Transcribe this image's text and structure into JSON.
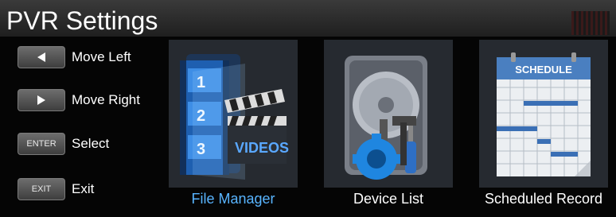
{
  "header": {
    "title": "PVR Settings"
  },
  "hints": [
    {
      "key_icon": "left-arrow-icon",
      "key_text": "",
      "label": "Move Left"
    },
    {
      "key_icon": "right-arrow-icon",
      "key_text": "",
      "label": "Move Right"
    },
    {
      "key_icon": "",
      "key_text": "ENTER",
      "label": "Select"
    },
    {
      "key_icon": "",
      "key_text": "EXIT",
      "label": "Exit"
    }
  ],
  "tiles": [
    {
      "label": "File Manager",
      "icon": "video-folder-icon",
      "selected": true,
      "icon_text": [
        "1",
        "2",
        "3",
        "VIDEOS"
      ]
    },
    {
      "label": "Device List",
      "icon": "hard-drive-tools-icon",
      "selected": false
    },
    {
      "label": "Scheduled Record",
      "icon": "schedule-calendar-icon",
      "selected": false,
      "icon_text": [
        "SCHEDULE"
      ]
    }
  ],
  "colors": {
    "selected_label": "#58b4ff",
    "accent_blue": "#1f86e0"
  }
}
